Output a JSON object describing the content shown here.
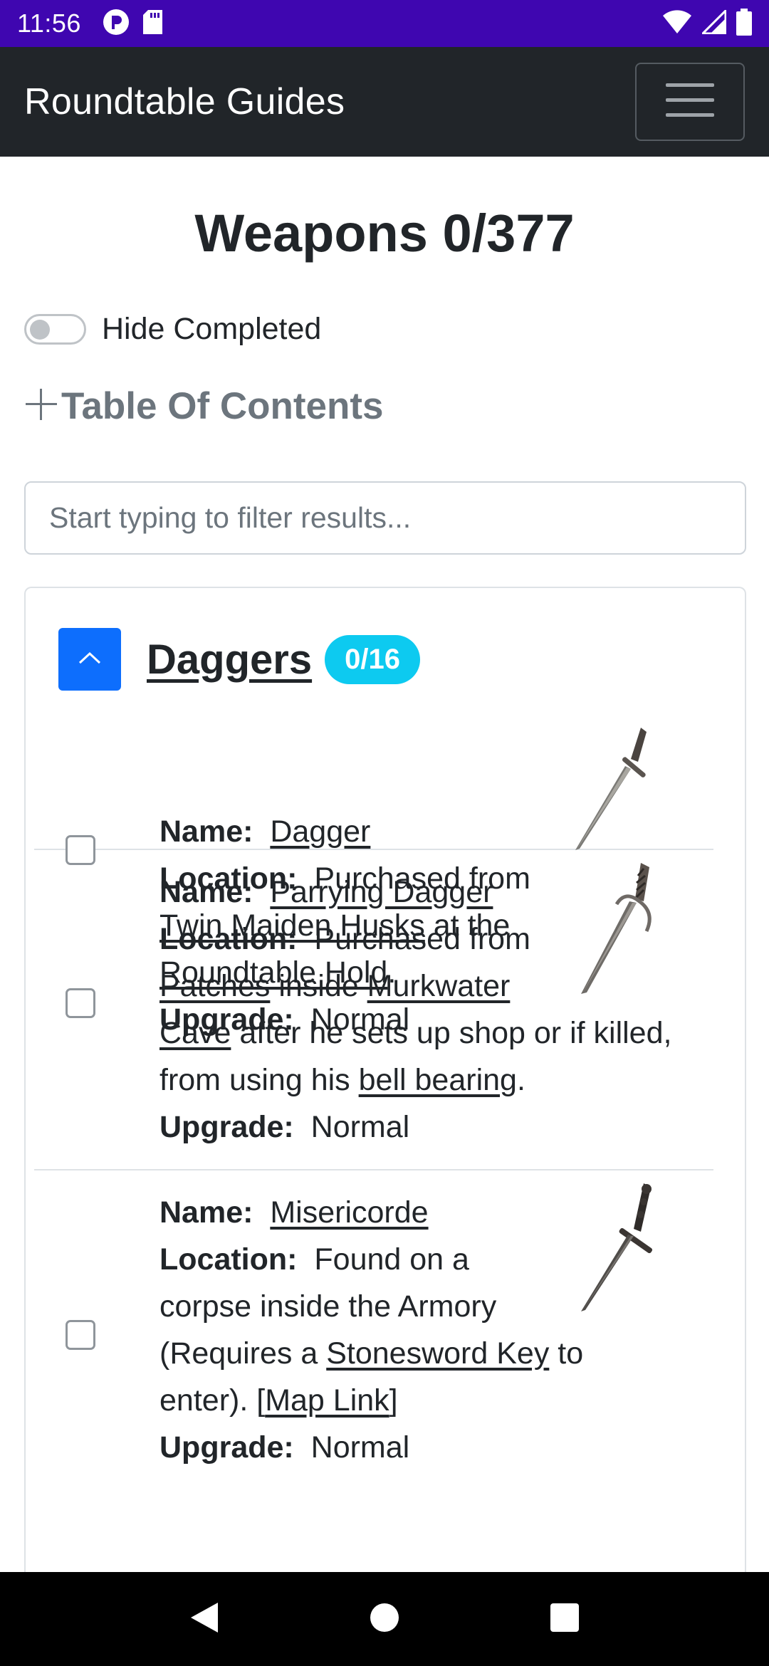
{
  "status_bar": {
    "time": "11:56"
  },
  "navbar": {
    "brand": "Roundtable Guides"
  },
  "page": {
    "title": "Weapons 0/377",
    "hide_completed_label": "Hide Completed",
    "toc_label": "Table Of Contents",
    "filter_placeholder": "Start typing to filter results..."
  },
  "category": {
    "title": "Daggers",
    "badge": "0/16",
    "items": [
      {
        "name_label": "Name:",
        "name": "Dagger",
        "location_label": "Location:",
        "loc_parts": [
          "Purchased from",
          "Twin Maiden Husks",
          "at the",
          "Roundtable Hold",
          "."
        ],
        "upgrade_label": "Upgrade:",
        "upgrade": "Normal"
      },
      {
        "name_label": "Name:",
        "name": "Parrying Dagger",
        "location_label": "Location:",
        "loc_parts": [
          "Purchased from",
          "Patches",
          "inside",
          "Murkwater",
          "Cave",
          "after he sets up shop or if killed,",
          "from using his",
          "bell bearing",
          "."
        ],
        "upgrade_label": "Upgrade:",
        "upgrade": "Normal"
      },
      {
        "name_label": "Name:",
        "name": "Misericorde",
        "location_label": "Location:",
        "loc_parts": [
          "Found on a",
          "corpse inside the Armory",
          "(Requires a",
          "Stonesword Key",
          "to",
          "enter).",
          "[",
          "Map Link",
          "]"
        ],
        "upgrade_label": "Upgrade:",
        "upgrade": "Normal"
      }
    ]
  },
  "colors": {
    "status_bar": "#3f06b0",
    "navbar": "#212529",
    "primary": "#0d6efd",
    "badge": "#0dcaf0"
  }
}
